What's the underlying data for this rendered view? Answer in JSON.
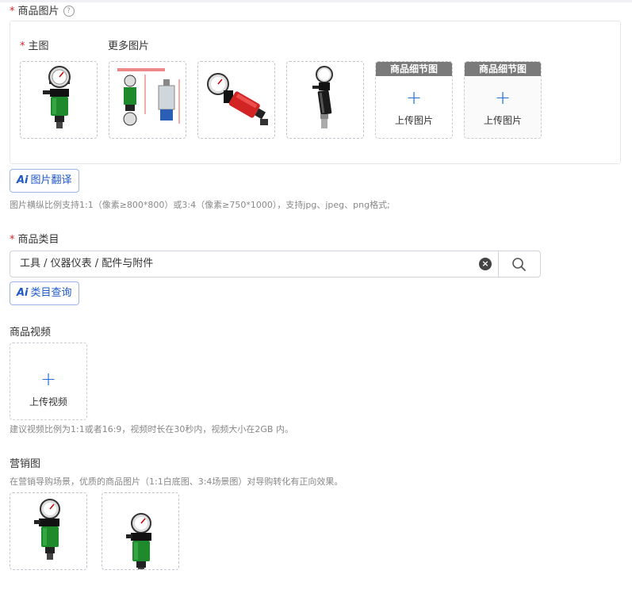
{
  "product_images": {
    "label": "商品图片",
    "help_icon": "?",
    "main_label": "主图",
    "more_label": "更多图片",
    "detail_header": "商品细节图",
    "upload_text": "上传图片",
    "plus": "+"
  },
  "image_translate": {
    "ai": "Ai",
    "label": "图片翻译"
  },
  "image_hint": "图片横纵比例支持1:1（像素≥800*800）或3:4（像素≥750*1000），支持jpg、jpeg、png格式;",
  "category": {
    "label": "商品类目",
    "value": "工具 / 仪器仪表 / 配件与附件",
    "clear_icon": "×"
  },
  "category_query": {
    "ai": "Ai",
    "label": "类目查询"
  },
  "video": {
    "label": "商品视频",
    "plus": "+",
    "upload_text": "上传视频",
    "hint": "建议视频比例为1:1或者16:9，视频时长在30秒内，视频大小在2GB 内。"
  },
  "marketing": {
    "label": "营销图",
    "hint": "在营销导购场景，优质的商品图片（1:1白底图、3:4场景图）对导购转化有正向效果。"
  },
  "required_mark": "*",
  "colors": {
    "accent": "#1e6fd9",
    "required": "#e02020",
    "product_green": "#1f8a2c",
    "product_red": "#d32424"
  }
}
